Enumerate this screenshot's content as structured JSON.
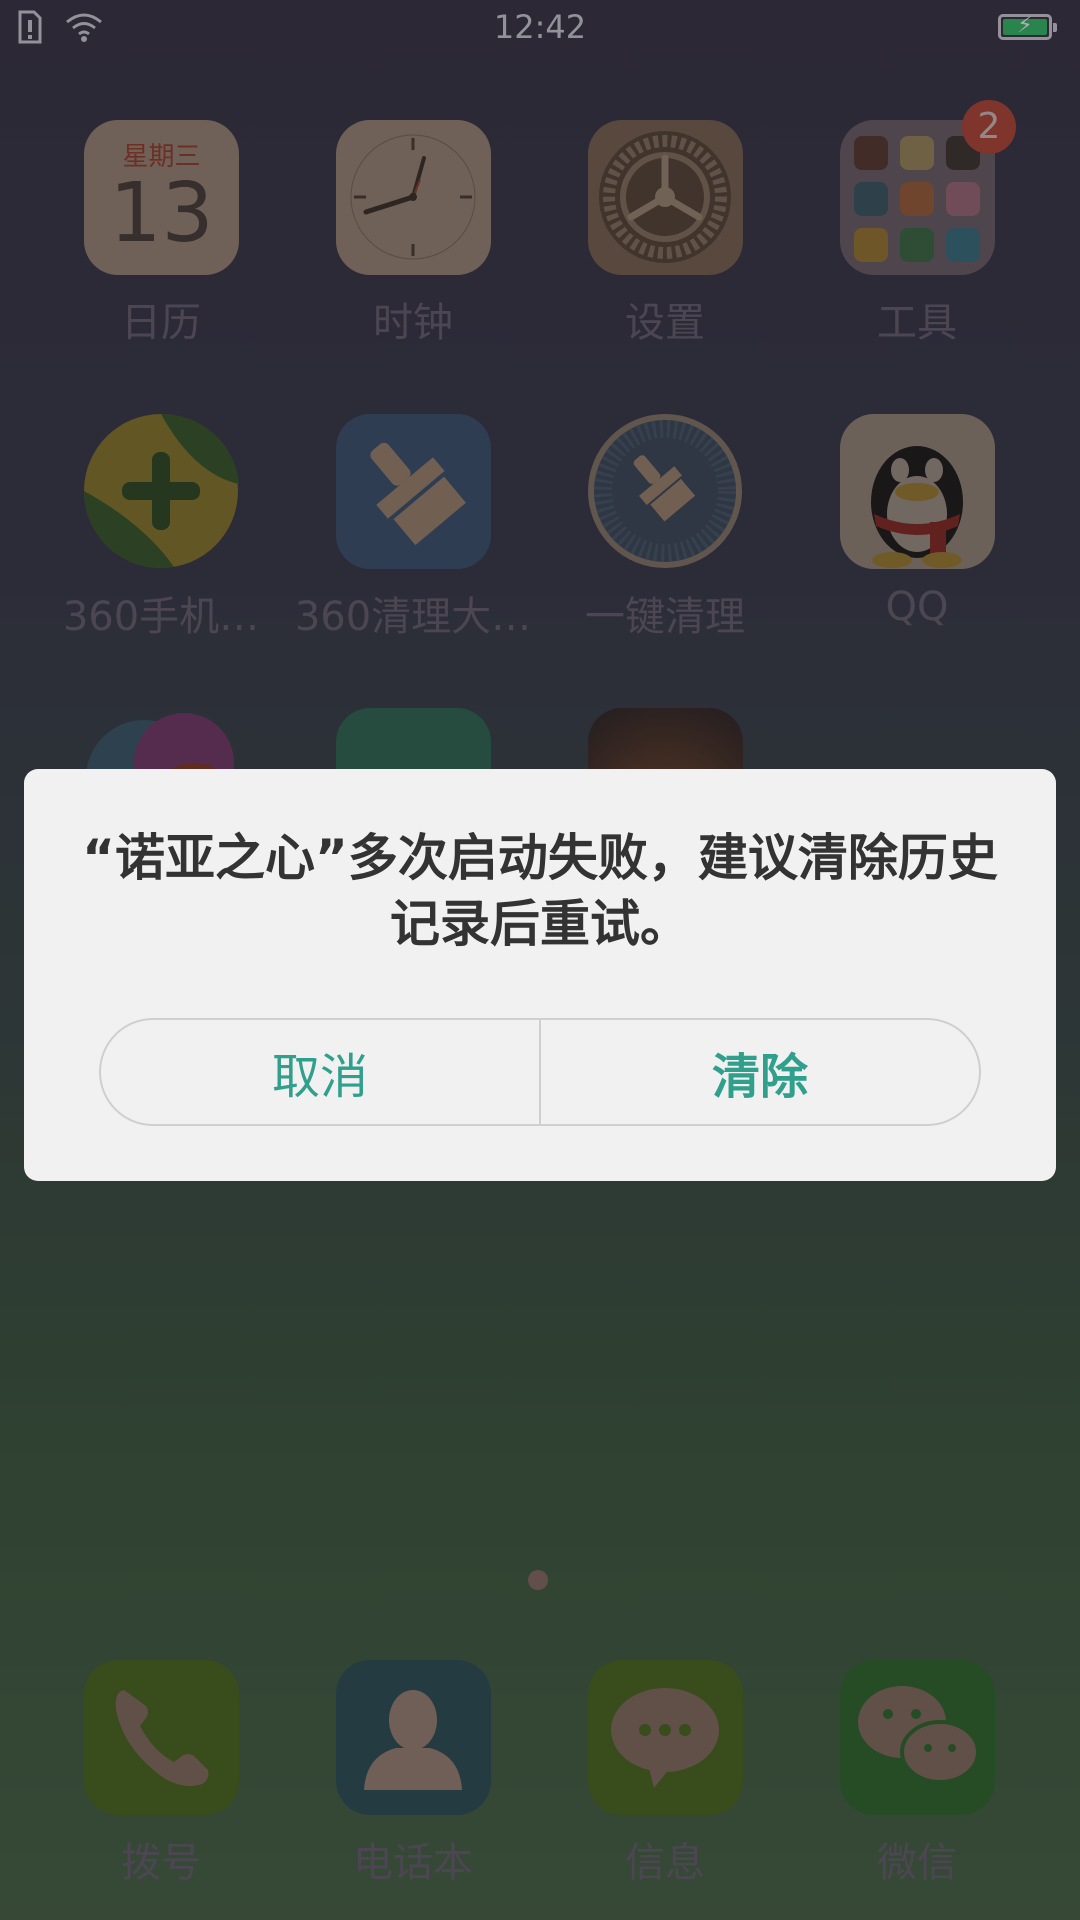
{
  "status_bar": {
    "time": "12:42"
  },
  "apps_row1": [
    {
      "label": "日历",
      "calendar_weekday": "星期三",
      "calendar_day": "13"
    },
    {
      "label": "时钟"
    },
    {
      "label": "设置"
    },
    {
      "label": "工具",
      "badge": "2"
    }
  ],
  "apps_row2": [
    {
      "label": "360手机…"
    },
    {
      "label": "360清理大…"
    },
    {
      "label": "一键清理"
    },
    {
      "label": "QQ"
    }
  ],
  "dock": [
    {
      "label": "拨号"
    },
    {
      "label": "电话本"
    },
    {
      "label": "信息"
    },
    {
      "label": "微信"
    }
  ],
  "dialog": {
    "message": "“诺亚之心”多次启动失败，建议清除历史记录后重试。",
    "cancel_label": "取消",
    "clear_label": "清除",
    "accent_color": "#30a08c"
  }
}
